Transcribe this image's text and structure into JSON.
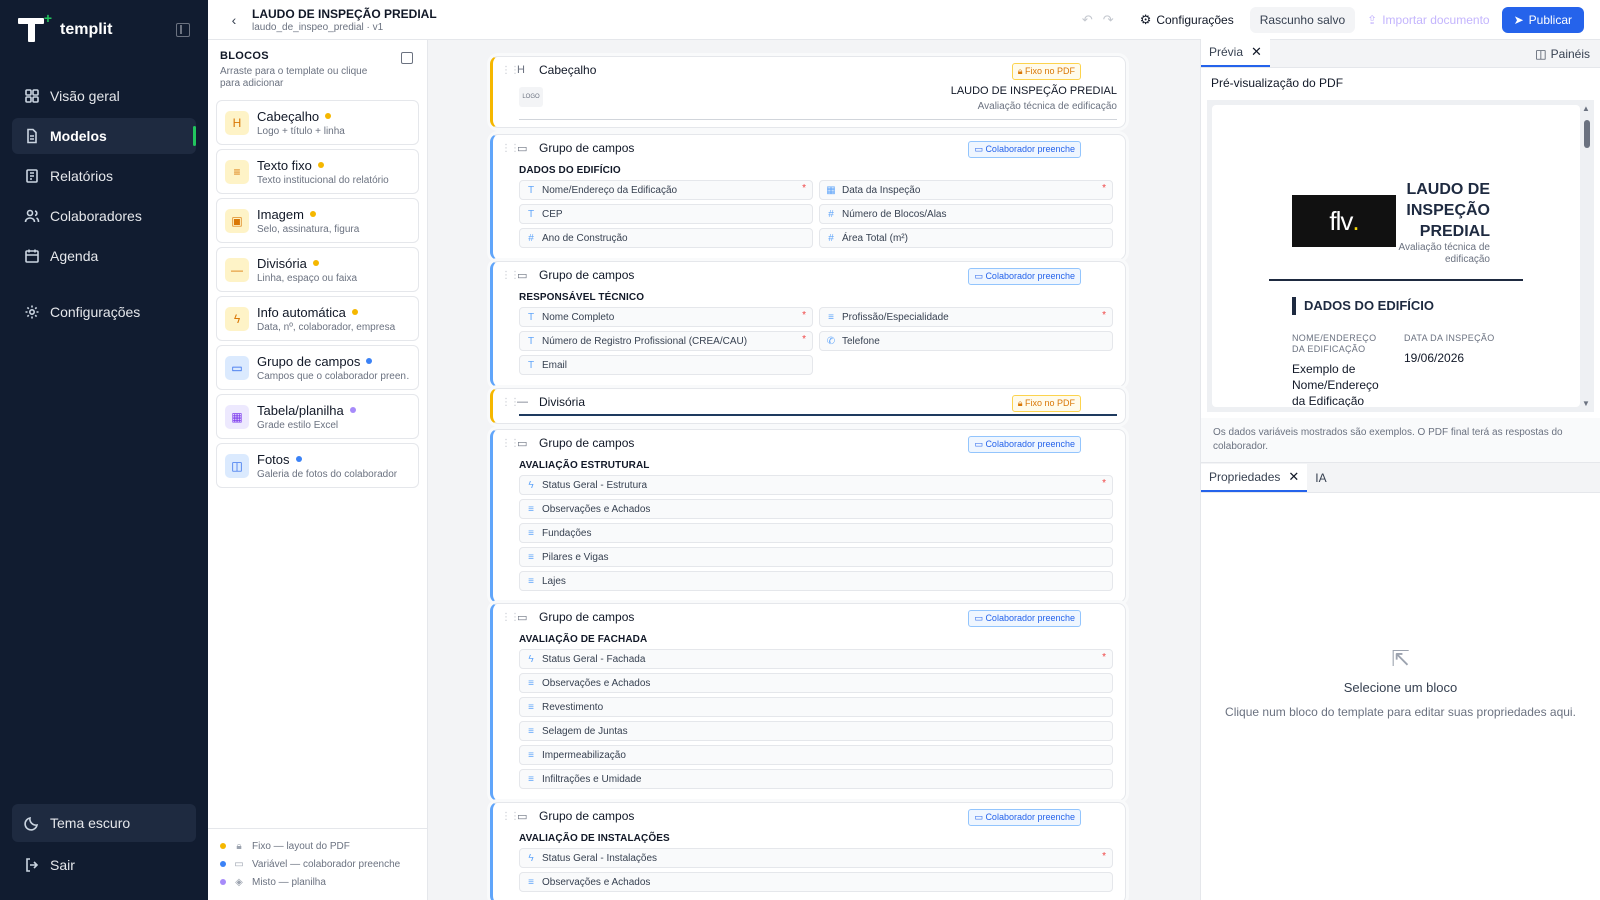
{
  "brand": {
    "name": "templit"
  },
  "nav": {
    "items": [
      {
        "label": "Visão geral"
      },
      {
        "label": "Modelos"
      },
      {
        "label": "Relatórios"
      },
      {
        "label": "Colaboradores"
      },
      {
        "label": "Agenda"
      },
      {
        "label": "Configurações"
      }
    ],
    "theme_label": "Tema escuro",
    "logout_label": "Sair"
  },
  "topbar": {
    "title": "LAUDO DE INSPEÇÃO PREDIAL",
    "subtitle": "laudo_de_inspeo_predial · v1",
    "settings_label": "Configurações",
    "saved_label": "Rascunho salvo",
    "import_label": "Importar documento",
    "publish_label": "Publicar"
  },
  "blocks": {
    "heading": "BLOCOS",
    "subheading": "Arraste para o template ou clique para adicionar",
    "items": [
      {
        "icon_text": "H",
        "name": "Cabeçalho",
        "desc": "Logo + título + linha",
        "kind": "fixed"
      },
      {
        "icon_text": "≡",
        "name": "Texto fixo",
        "desc": "Texto institucional do relatório",
        "kind": "fixed"
      },
      {
        "icon_text": "▣",
        "name": "Imagem",
        "desc": "Selo, assinatura, figura",
        "kind": "fixed"
      },
      {
        "icon_text": "—",
        "name": "Divisória",
        "desc": "Linha, espaço ou faixa",
        "kind": "fixed"
      },
      {
        "icon_text": "ϟ",
        "name": "Info automática",
        "desc": "Data, nº, colaborador, empresa",
        "kind": "fixed"
      },
      {
        "icon_text": "▭",
        "name": "Grupo de campos",
        "desc": "Campos que o colaborador preenche",
        "kind": "variable"
      },
      {
        "icon_text": "▦",
        "name": "Tabela/planilha",
        "desc": "Grade estilo Excel",
        "kind": "mixed"
      },
      {
        "icon_text": "◫",
        "name": "Fotos",
        "desc": "Galeria de fotos do colaborador",
        "kind": "variable"
      }
    ],
    "legend": [
      {
        "label": "Fixo — layout do PDF",
        "color": "#f5b700"
      },
      {
        "label": "Variável — colaborador preenche",
        "color": "#3b82f6"
      },
      {
        "label": "Misto — planilha",
        "color": "#a78bfa"
      }
    ]
  },
  "canvas": {
    "header_block": {
      "title": "Cabeçalho",
      "badge": "Fixo no PDF",
      "logo_placeholder": "LOGO",
      "doc_title": "LAUDO DE INSPEÇÃO PREDIAL",
      "doc_subtitle": "Avaliação técnica de edificação"
    },
    "divider_block": {
      "title": "Divisória",
      "badge": "Fixo no PDF"
    },
    "group_title": "Grupo de campos",
    "group_badge": "Colaborador preenche",
    "groups": [
      {
        "section": "DADOS DO EDIFÍCIO",
        "fields": [
          {
            "label": "Nome/Endereço da Edificação",
            "icon": "T",
            "required": true
          },
          {
            "label": "Data da Inspeção",
            "icon": "▦",
            "required": true
          },
          {
            "label": "CEP",
            "icon": "T",
            "required": false
          },
          {
            "label": "Número de Blocos/Alas",
            "icon": "#",
            "required": false
          },
          {
            "label": "Ano de Construção",
            "icon": "#",
            "required": false
          },
          {
            "label": "Área Total (m²)",
            "icon": "#",
            "required": false
          }
        ]
      },
      {
        "section": "RESPONSÁVEL TÉCNICO",
        "fields": [
          {
            "label": "Nome Completo",
            "icon": "T",
            "required": true
          },
          {
            "label": "Profissão/Especialidade",
            "icon": "≡",
            "required": true
          },
          {
            "label": "Número de Registro Profissional (CREA/CAU)",
            "icon": "T",
            "required": true
          },
          {
            "label": "Telefone",
            "icon": "✆",
            "required": false
          },
          {
            "label": "Email",
            "icon": "T",
            "required": false
          }
        ]
      },
      {
        "section": "AVALIAÇÃO ESTRUTURAL",
        "fields": [
          {
            "label": "Status Geral - Estrutura",
            "icon": "ϟ",
            "required": true
          },
          {
            "label": "Observações e Achados",
            "icon": "≡",
            "required": false
          },
          {
            "label": "Fundações",
            "icon": "≡",
            "required": false
          },
          {
            "label": "Pilares e Vigas",
            "icon": "≡",
            "required": false
          },
          {
            "label": "Lajes",
            "icon": "≡",
            "required": false
          }
        ]
      },
      {
        "section": "AVALIAÇÃO DE FACHADA",
        "fields": [
          {
            "label": "Status Geral - Fachada",
            "icon": "ϟ",
            "required": true
          },
          {
            "label": "Observações e Achados",
            "icon": "≡",
            "required": false
          },
          {
            "label": "Revestimento",
            "icon": "≡",
            "required": false
          },
          {
            "label": "Selagem de Juntas",
            "icon": "≡",
            "required": false
          },
          {
            "label": "Impermeabilização",
            "icon": "≡",
            "required": false
          },
          {
            "label": "Infiltrações e Umidade",
            "icon": "≡",
            "required": false
          }
        ]
      },
      {
        "section": "AVALIAÇÃO DE INSTALAÇÕES",
        "fields": [
          {
            "label": "Status Geral - Instalações",
            "icon": "ϟ",
            "required": true
          },
          {
            "label": "Observações e Achados",
            "icon": "≡",
            "required": false
          }
        ]
      }
    ]
  },
  "right_panel": {
    "preview_tab": "Prévia",
    "panels_label": "Painéis",
    "preview_label": "Pré-visualização do PDF",
    "pdf": {
      "logo_text": "flv",
      "logo_dot": ".",
      "title": "LAUDO DE INSPEÇÃO PREDIAL",
      "subtitle": "Avaliação técnica de edificação",
      "section": "DADOS DO EDIFÍCIO",
      "col1_label": "NOME/ENDEREÇO DA EDIFICAÇÃO",
      "col1_value": "Exemplo de Nome/Endereço da Edificação",
      "col2_label": "DATA DA INSPEÇÃO",
      "col2_value": "19/06/2026"
    },
    "note": "Os dados variáveis mostrados são exemplos. O PDF final terá as respostas do colaborador.",
    "properties_tab": "Propriedades",
    "ai_tab": "IA",
    "empty_title": "Selecione um bloco",
    "empty_subtitle": "Clique num bloco do template para editar suas propriedades aqui."
  }
}
